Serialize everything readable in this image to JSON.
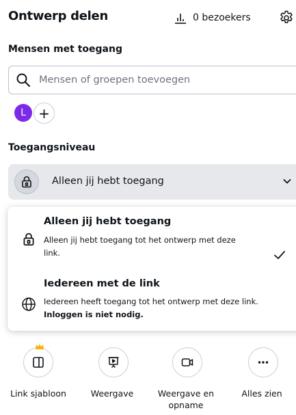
{
  "header": {
    "title": "Ontwerp delen",
    "visitors_label": "0 bezoekers"
  },
  "people": {
    "section_label": "Mensen met toegang",
    "search_placeholder": "Mensen of groepen toevoegen",
    "avatar_initial": "L",
    "add_symbol": "+"
  },
  "access": {
    "section_label": "Toegangsniveau",
    "selected_value": "Alleen jij hebt toegang",
    "options": [
      {
        "title": "Alleen jij hebt toegang",
        "description": "Alleen jij hebt toegang tot het ontwerp met deze link.",
        "selected": true
      },
      {
        "title": "Iedereen met de link",
        "description": "Iedereen heeft toegang tot het ontwerp met deze link.",
        "description_bold": "Inloggen is niet nodig.",
        "selected": false
      }
    ]
  },
  "actions": [
    {
      "label": "Link sjabloon",
      "icon": "template-icon"
    },
    {
      "label": "Weergave",
      "icon": "present-icon"
    },
    {
      "label": "Weergave en opname",
      "icon": "record-icon"
    },
    {
      "label": "Alles zien",
      "icon": "more-icon"
    }
  ],
  "colors": {
    "avatar": "#7d2ae8",
    "crown": "#f5b400",
    "select_bg": "#e6e8ec"
  }
}
